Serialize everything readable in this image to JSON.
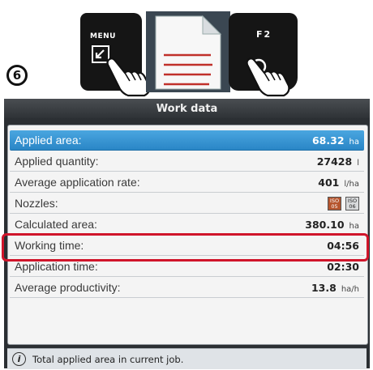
{
  "instruction": {
    "step_number": "6",
    "menu_key_label": "MENU",
    "f2_key_label": "F2"
  },
  "screen": {
    "title": "Work data",
    "rows": [
      {
        "label": "Applied area:",
        "value": "68.32",
        "unit": "ha",
        "selected": true
      },
      {
        "label": "Applied quantity:",
        "value": "27428",
        "unit": "l"
      },
      {
        "label": "Average application rate:",
        "value": "401",
        "unit": "l/ha"
      },
      {
        "label": "Nozzles:",
        "value": "",
        "unit": ""
      },
      {
        "label": "Calculated area:",
        "value": "380.10",
        "unit": "ha",
        "highlighted": true
      },
      {
        "label": "Working time:",
        "value": "04:56",
        "unit": ""
      },
      {
        "label": "Application time:",
        "value": "02:30",
        "unit": ""
      },
      {
        "label": "Average productivity:",
        "value": "13.8",
        "unit": "ha/h"
      }
    ],
    "nozzle_badges": [
      {
        "top": "ISO",
        "bottom": "05",
        "color": "#b5552e"
      },
      {
        "top": "ISO",
        "bottom": "06",
        "color": "#d8dadc"
      }
    ],
    "info_text": "Total applied area in current job.",
    "colors": {
      "selection": "#2a86c6",
      "highlight_frame": "#d0152b",
      "title_bar": "#3a3e42"
    }
  }
}
